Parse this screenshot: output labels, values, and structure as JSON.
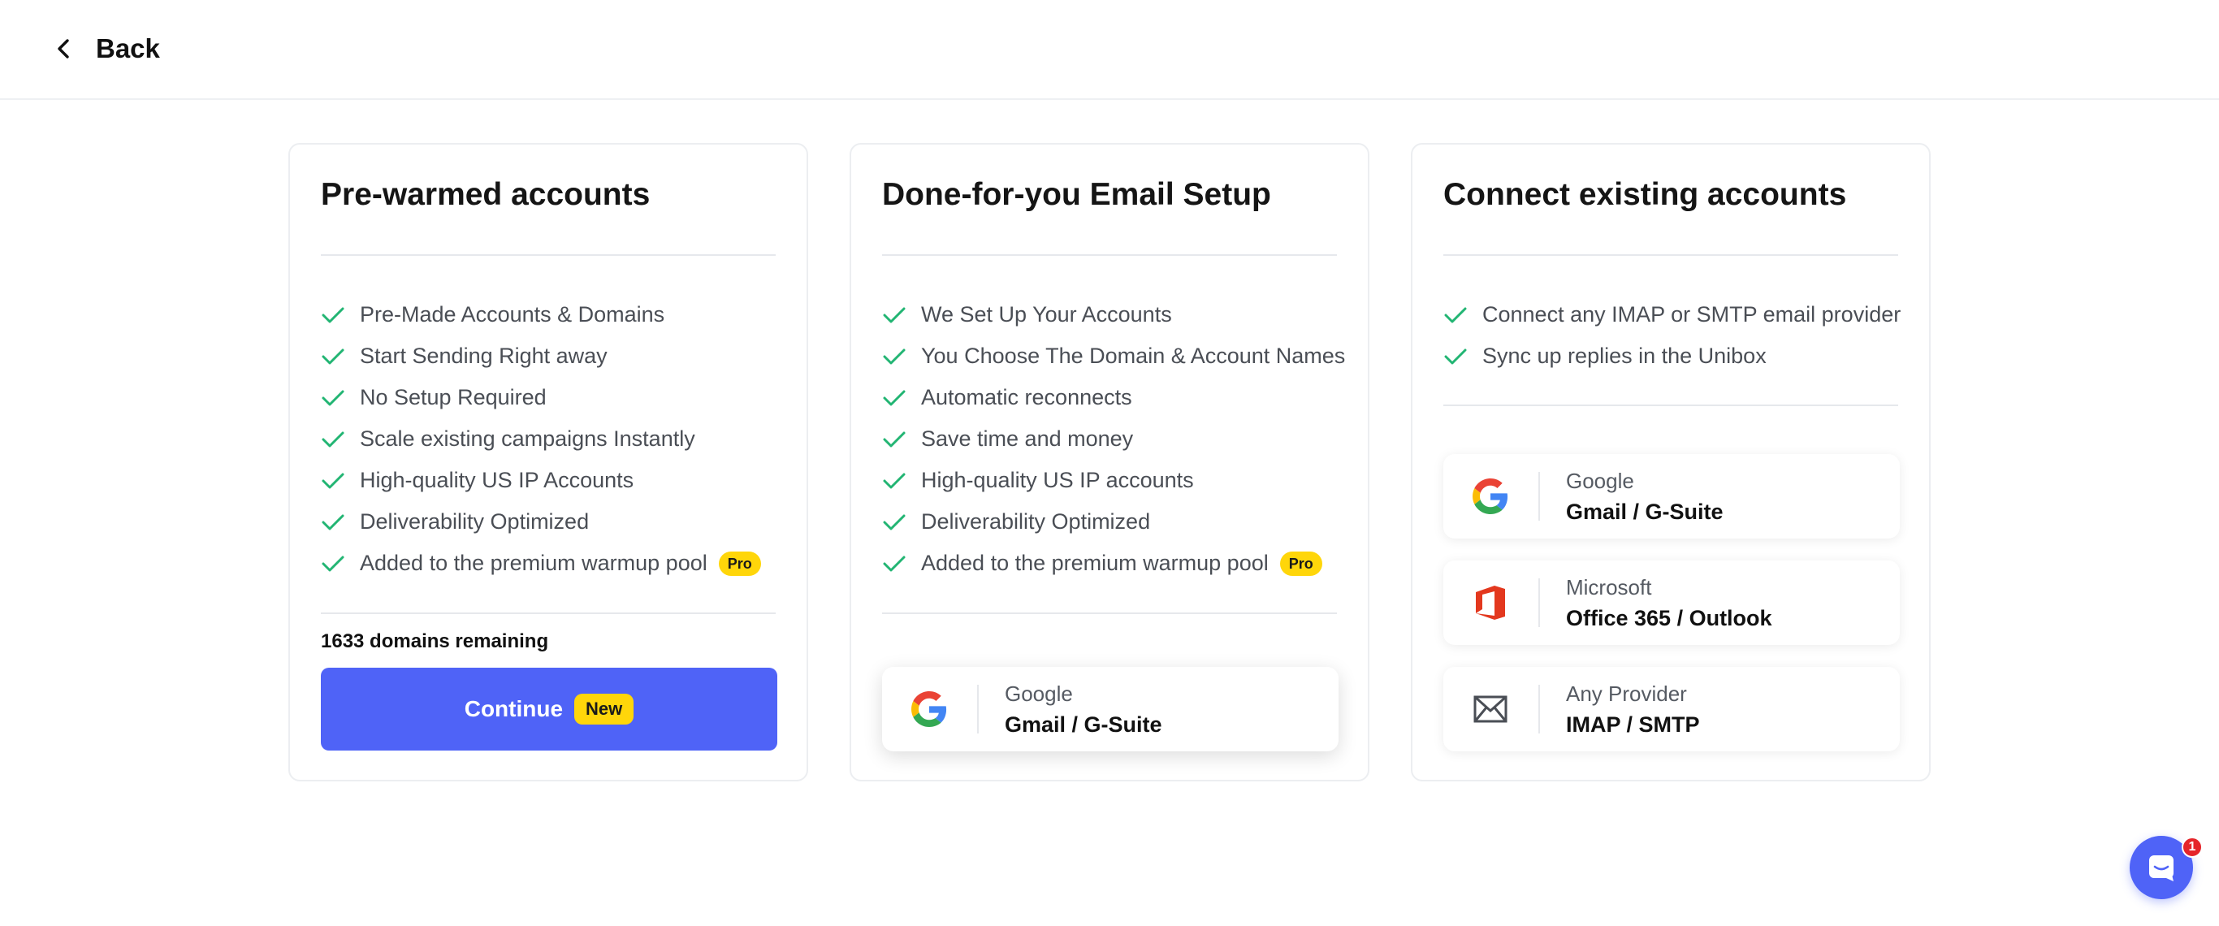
{
  "header": {
    "back_label": "Back"
  },
  "cards": {
    "prewarmed": {
      "title": "Pre-warmed accounts",
      "features": [
        "Pre-Made Accounts & Domains",
        "Start Sending Right away",
        "No Setup Required",
        "Scale existing campaigns Instantly",
        "High-quality US IP Accounts",
        "Deliverability Optimized",
        "Added to the premium warmup pool"
      ],
      "pro_badge": "Pro",
      "remaining": "1633 domains remaining",
      "continue_label": "Continue",
      "new_badge": "New"
    },
    "dfy": {
      "title": "Done-for-you Email Setup",
      "features": [
        "We Set Up Your Accounts",
        "You Choose The Domain & Account Names",
        "Automatic reconnects",
        "Save time and money",
        "High-quality US IP accounts",
        "Deliverability Optimized",
        "Added to the premium warmup pool"
      ],
      "pro_badge": "Pro",
      "provider": {
        "name": "Google",
        "desc": "Gmail / G-Suite",
        "icon": "google-icon"
      }
    },
    "connect": {
      "title": "Connect existing accounts",
      "features": [
        "Connect any IMAP or SMTP email provider",
        "Sync up replies in the Unibox"
      ],
      "providers": [
        {
          "name": "Google",
          "desc": "Gmail / G-Suite",
          "icon": "google-icon"
        },
        {
          "name": "Microsoft",
          "desc": "Office 365 / Outlook",
          "icon": "office-icon"
        },
        {
          "name": "Any Provider",
          "desc": "IMAP / SMTP",
          "icon": "envelope-icon"
        }
      ]
    }
  },
  "chat": {
    "badge_count": "1",
    "icon": "chat-icon"
  },
  "colors": {
    "accent": "#4f63f7",
    "check": "#22b573",
    "badge_yellow": "#ffd60a",
    "notification_red": "#e5252a"
  }
}
